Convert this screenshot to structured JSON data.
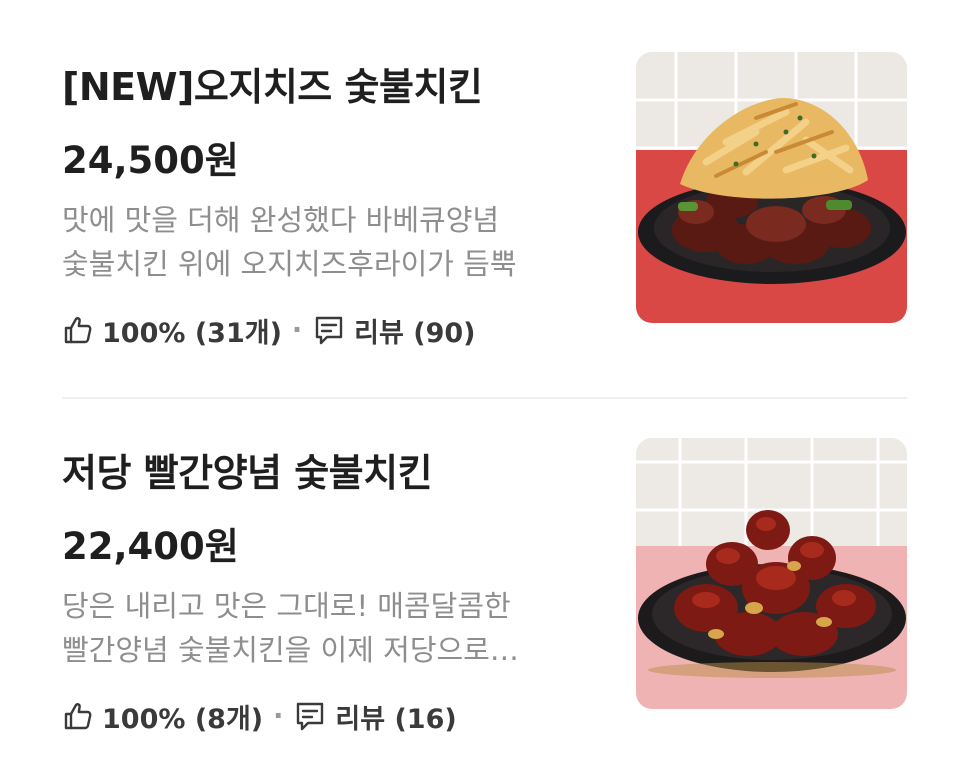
{
  "items": [
    {
      "name": "[NEW]오지치즈 숯불치킨",
      "price": "24,500원",
      "description_lines": [
        "맛에 맛을 더해 완성했다 바베큐양념",
        "숯불치킨 위에 오지치즈후라이가 듬뿍"
      ],
      "likes": "100% (31개)",
      "separator": "·",
      "reviews": "리뷰 (90)",
      "icons": [
        "thumbs-up-icon",
        "review-bubble-icon"
      ]
    },
    {
      "name": "저당 빨간양념 숯불치킨",
      "price": "22,400원",
      "description_lines": [
        "당은 내리고 맛은 그대로! 매콤달콤한",
        "빨간양념 숯불치킨을 이제 저당으로…"
      ],
      "likes": "100% (8개)",
      "separator": "·",
      "reviews": "리뷰 (16)",
      "icons": [
        "thumbs-up-icon",
        "review-bubble-icon"
      ]
    }
  ],
  "colors": {
    "title": "#1f1f1f",
    "description": "#8e8e8e",
    "meta": "#3a3a3a",
    "divider": "#efefef"
  }
}
